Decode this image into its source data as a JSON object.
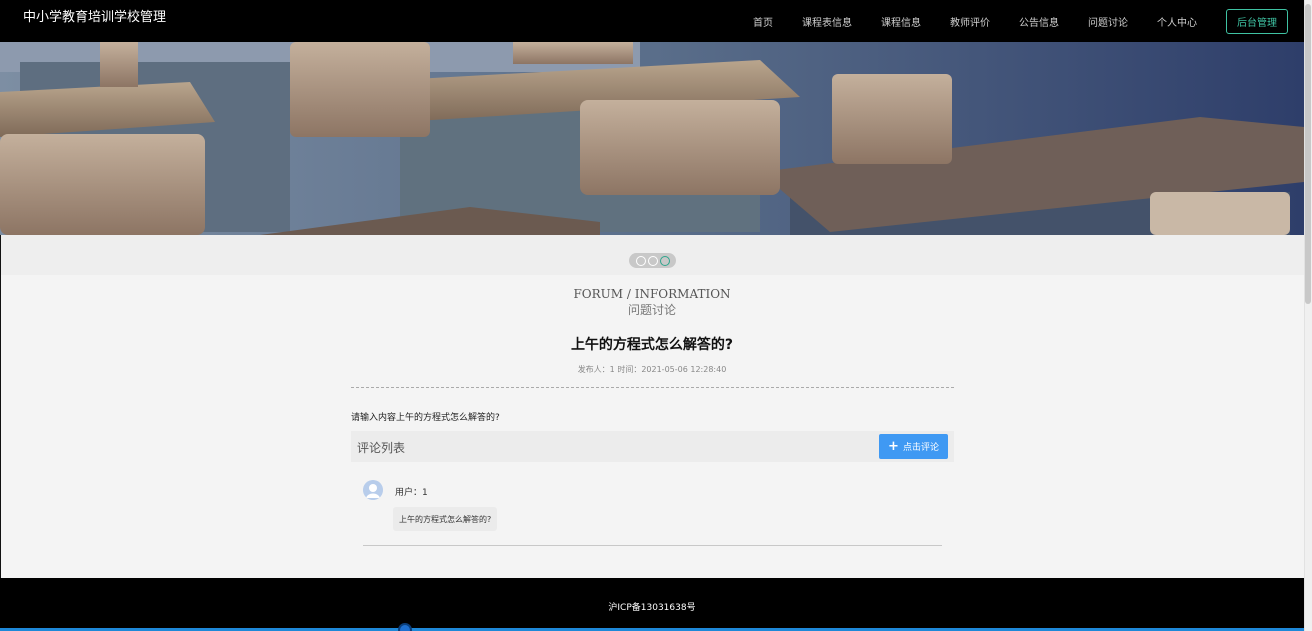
{
  "header": {
    "brand": "中小学教育培训学校管理",
    "nav": [
      {
        "label": "首页"
      },
      {
        "label": "课程表信息"
      },
      {
        "label": "课程信息"
      },
      {
        "label": "教师评价"
      },
      {
        "label": "公告信息"
      },
      {
        "label": "问题讨论"
      },
      {
        "label": "个人中心"
      }
    ],
    "admin_label": "后台管理"
  },
  "carousel": {
    "dots": 3,
    "active_index": 2
  },
  "section": {
    "title_en": "FORUM / INFORMATION",
    "title_cn": "问题讨论"
  },
  "post": {
    "title": "上午的方程式怎么解答的?",
    "meta": "发布人：1 时间：2021-05-06 12:28:40",
    "content": "请输入内容上午的方程式怎么解答的?"
  },
  "comments": {
    "title": "评论列表",
    "add_label": "点击评论",
    "items": [
      {
        "user": "用户：1",
        "text": "上午的方程式怎么解答的?"
      }
    ]
  },
  "footer": {
    "icp": "沪ICP备13031638号"
  },
  "colors": {
    "accent": "#3fc3a3",
    "button_blue": "#3f99f3",
    "dark": "#000000"
  }
}
